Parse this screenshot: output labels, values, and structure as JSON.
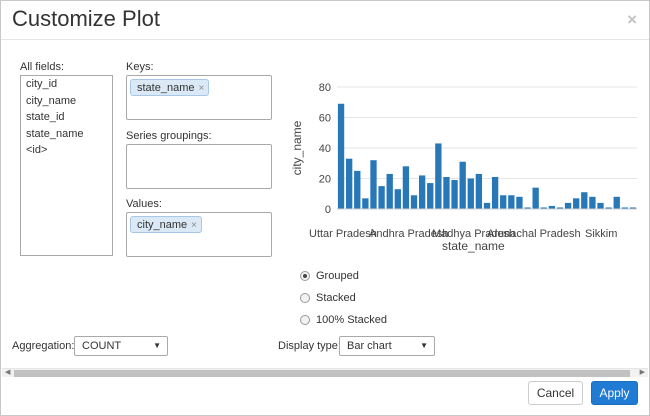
{
  "dialog": {
    "title": "Customize Plot",
    "close_glyph": "×"
  },
  "fields": {
    "label": "All fields:",
    "items": [
      "city_id",
      "city_name",
      "state_id",
      "state_name",
      "<id>"
    ]
  },
  "keys": {
    "label": "Keys:",
    "chip": "state_name",
    "chip_remove": "×"
  },
  "series_groupings": {
    "label": "Series groupings:"
  },
  "values": {
    "label": "Values:",
    "chip": "city_name",
    "chip_remove": "×"
  },
  "chart_data": {
    "type": "bar",
    "xlabel": "state_name",
    "ylabel": "city_name",
    "ylim": [
      0,
      80
    ],
    "yticks": [
      0,
      20,
      40,
      60,
      80
    ],
    "category_labels": [
      "Uttar Pradesh",
      "Andhra Pradesh",
      "Madhya Pradesh",
      "Arunachal Pradesh",
      "Sikkim"
    ],
    "values": [
      69,
      33,
      25,
      7,
      32,
      15,
      23,
      13,
      28,
      9,
      22,
      17,
      43,
      21,
      19,
      31,
      20,
      23,
      4,
      21,
      9,
      9,
      8,
      1,
      14,
      1,
      2,
      1,
      4,
      7,
      11,
      8,
      4,
      1,
      8,
      1,
      1
    ],
    "color": "#2878b8",
    "grid": true
  },
  "stack_mode": {
    "options": [
      "Grouped",
      "Stacked",
      "100% Stacked"
    ],
    "selected": "Grouped"
  },
  "aggregation": {
    "label": "Aggregation:",
    "value": "COUNT"
  },
  "display_type": {
    "label": "Display type:",
    "value": "Bar chart"
  },
  "footer": {
    "cancel": "Cancel",
    "apply": "Apply"
  }
}
